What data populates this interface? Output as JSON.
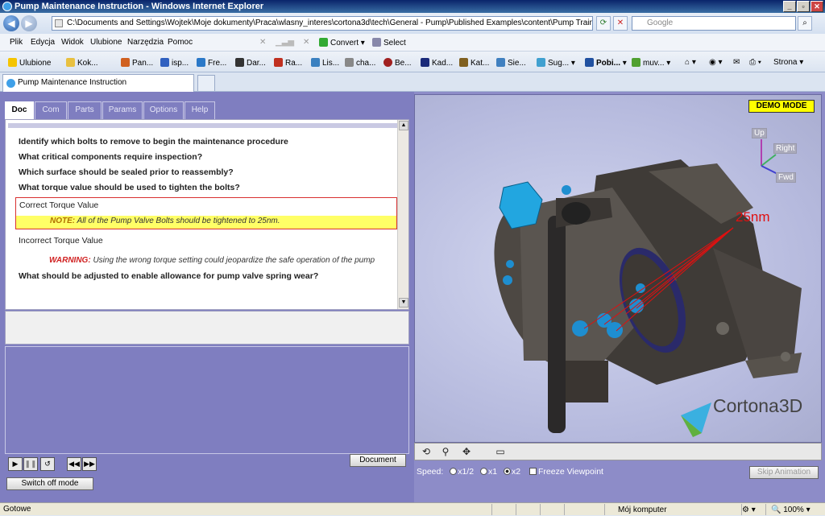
{
  "window": {
    "title": "Pump Maintenance Instruction - Windows Internet Explorer"
  },
  "address": {
    "url": "C:\\Documents and Settings\\Wojtek\\Moje dokumenty\\Praca\\wlasny_interes\\cortona3d\\tech\\General - Pump\\Published Examples\\content\\Pump Training - Complete.htm",
    "search_placeholder": "Google"
  },
  "menu": {
    "items": [
      "Plik",
      "Edycja",
      "Widok",
      "Ulubione",
      "Narzędzia",
      "Pomoc"
    ],
    "convert": "Convert",
    "select": "Select"
  },
  "favorites": {
    "label": "Ulubione",
    "items": [
      "Kok...",
      "Pan...",
      "isp...",
      "Fre...",
      "Dar...",
      "Ra...",
      "Lis...",
      "cha...",
      "Be...",
      "Kad...",
      "Kat...",
      "Sie...",
      "Sug...",
      "Pobi...",
      "muv..."
    ],
    "page_menu": "Strona"
  },
  "tab": {
    "title": "Pump Maintenance Instruction"
  },
  "doc_tabs": [
    "Doc",
    "Com",
    "Parts",
    "Params",
    "Options",
    "Help"
  ],
  "doc": {
    "questions": [
      "Identify which bolts to remove to begin the maintenance procedure",
      "What critical components require inspection?",
      "Which surface should be sealed prior to reassembly?",
      "What torque value should be used to tighten the bolts?"
    ],
    "correct_label": "Correct Torque Value",
    "note_prefix": "NOTE:",
    "note_text": "All of the Pump Valve Bolts should be tightened to 25nm.",
    "incorrect_label": "Incorrect Torque Value",
    "warning_prefix": "WARNING:",
    "warning_text": "Using the wrong torque setting could jeopardize the safe operation of the pump",
    "last_question": "What should be adjusted to enable allowance for pump valve spring wear?"
  },
  "controls": {
    "document_button": "Document",
    "switch_button": "Switch off mode",
    "skip_button": "Skip Animation"
  },
  "viewport": {
    "demo_label": "DEMO MODE",
    "axes": {
      "up": "Up",
      "right": "Right",
      "fwd": "Fwd"
    },
    "torque_annotation": "25nm",
    "logo": "Cortona3D",
    "speed_label": "Speed:",
    "speed_options": [
      "x1/2",
      "x1",
      "x2"
    ],
    "speed_selected": "x2",
    "freeze_label": "Freeze Viewpoint"
  },
  "status": {
    "left": "Gotowe",
    "zone": "Mój komputer",
    "zoom": "100%"
  }
}
